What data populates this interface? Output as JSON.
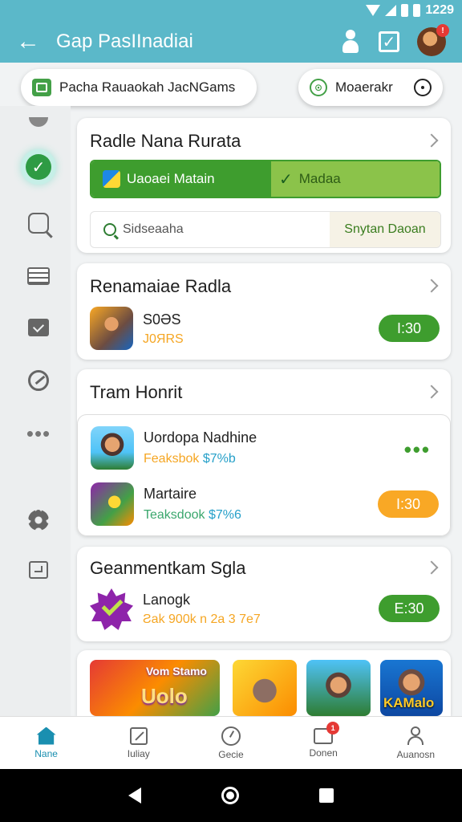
{
  "status_bar": {
    "time": "1229"
  },
  "app_bar": {
    "title": "Gap PasIInadiai"
  },
  "chips": {
    "left_label": "Pacha Rauaokah JacNGams",
    "right_label": "Moaerakr"
  },
  "card1": {
    "title": "Radle Nana Rurata",
    "seg_left": "Uaoaei Matain",
    "seg_right": "Madaa",
    "search_placeholder": "Sidseaaha",
    "search_button": "Snytan Daoan"
  },
  "card2": {
    "title": "Renamaiae Radla",
    "game": {
      "name": "S0ƏS",
      "meta": "J0ЯRS"
    },
    "price": "I:30"
  },
  "card3": {
    "title": "Tram Honrit",
    "games": [
      {
        "name": "Uordopa Nadhine",
        "meta_a": "Feaksbok",
        "meta_b": "$7%b"
      },
      {
        "name": "Martaire",
        "meta_a": "Teaksdook",
        "meta_b": "$7%6"
      }
    ],
    "more": "•••",
    "price": "I:30"
  },
  "card4": {
    "title": "Geanmentkam Sgla",
    "game": {
      "name": "Lanogk",
      "meta": "Ƨak 900k n 2a 3 7e7"
    },
    "price": "E:30"
  },
  "banner": {
    "tile1_top": "Vom Stamo",
    "tile1_main": "Uolo",
    "tile4_label": "KAMalo"
  },
  "bottom_nav": [
    {
      "label": "Nane",
      "icon": "home-icon"
    },
    {
      "label": "Iuliay",
      "icon": "library-icon"
    },
    {
      "label": "Gecie",
      "icon": "gauge-icon"
    },
    {
      "label": "Donen",
      "icon": "downloads-icon",
      "badge": "1"
    },
    {
      "label": "Auanosn",
      "icon": "person-icon"
    }
  ],
  "colors": {
    "appbar": "#5bb8c9",
    "accent_green": "#3e9d2e",
    "accent_orange": "#f9a825",
    "nav_active": "#1a8fb0"
  }
}
